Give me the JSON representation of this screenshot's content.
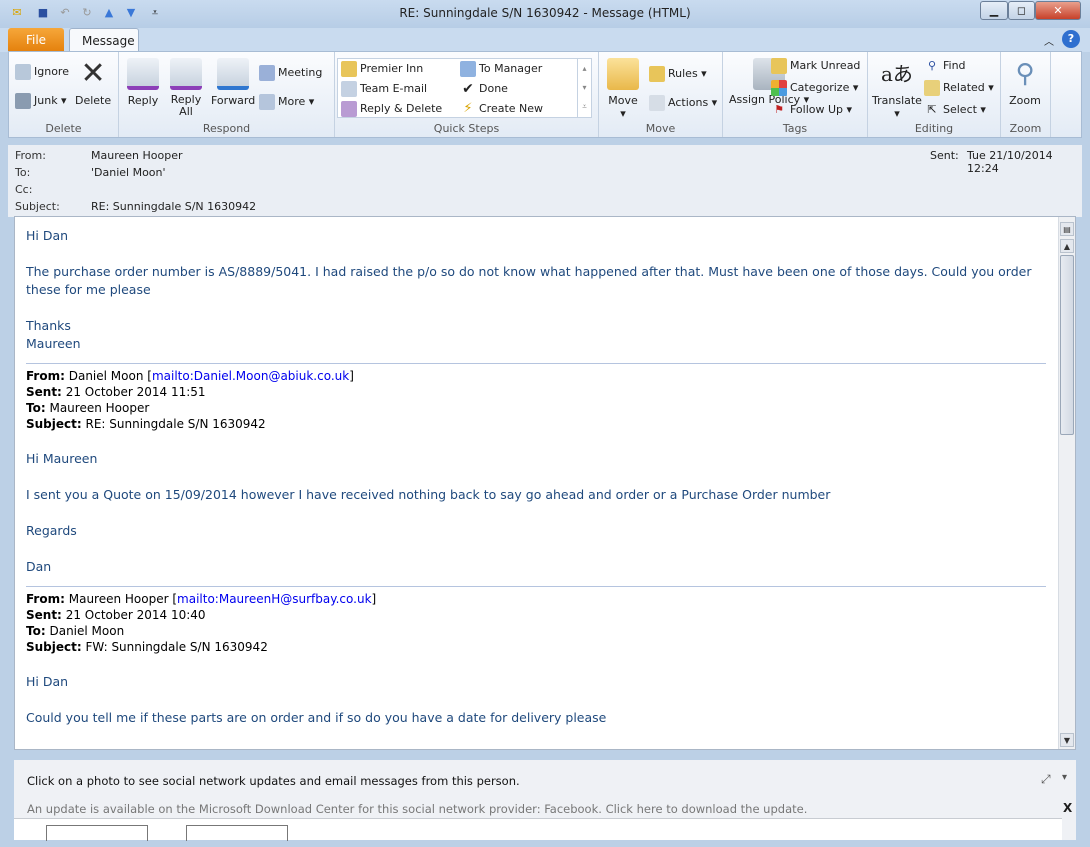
{
  "window": {
    "title": "RE: Sunningdale  S/N  1630942  -  Message (HTML)"
  },
  "tabs": [
    {
      "label": "File"
    },
    {
      "label": "Message"
    }
  ],
  "ribbon": {
    "delete": {
      "label": "Delete",
      "ignore": "Ignore",
      "junk": "Junk",
      "delete": "Delete"
    },
    "respond": {
      "label": "Respond",
      "reply": "Reply",
      "reply_all": "Reply All",
      "forward": "Forward",
      "meeting": "Meeting",
      "more": "More"
    },
    "quick_steps": {
      "label": "Quick Steps",
      "items": [
        "Premier Inn",
        "To Manager",
        "Team E-mail",
        "Done",
        "Reply & Delete",
        "Create New"
      ]
    },
    "move": {
      "label": "Move",
      "move": "Move",
      "rules": "Rules",
      "actions": "Actions"
    },
    "tags": {
      "label": "Tags",
      "assign_policy": "Assign Policy",
      "mark_unread": "Mark Unread",
      "categorize": "Categorize",
      "follow_up": "Follow Up"
    },
    "editing": {
      "label": "Editing",
      "translate": "Translate",
      "find": "Find",
      "related": "Related",
      "select": "Select"
    },
    "zoom": {
      "label": "Zoom",
      "zoom": "Zoom"
    }
  },
  "header": {
    "from_label": "From:",
    "from": "Maureen Hooper",
    "to_label": "To:",
    "to": "'Daniel Moon'",
    "cc_label": "Cc:",
    "subject_label": "Subject:",
    "subject": "RE: Sunningdale  S/N  1630942",
    "sent_label": "Sent:",
    "sent": "Tue 21/10/2014 12:24"
  },
  "body": {
    "greeting": "Hi Dan",
    "p1": "The purchase order number is AS/8889/5041.  I had raised the p/o so do not know what happened after that.  Must have been one of those days.  Could you order these for me please",
    "thanks": "Thanks",
    "sig": "Maureen",
    "q1": {
      "from_label": "From:",
      "from": "Daniel Moon [",
      "mail": "mailto:Daniel.Moon@abiuk.co.uk",
      "close": "]",
      "sent_label": "Sent:",
      "sent": "21 October 2014 11:51",
      "to_label": "To:",
      "to": "Maureen Hooper",
      "subject_label": "Subject:",
      "subject": "RE: Sunningdale S/N 1630942",
      "greeting": "Hi Maureen",
      "p1": "I sent you a Quote on 15/09/2014 however I have received nothing back to say go ahead and order or a Purchase Order number",
      "regards": "Regards",
      "sig": "Dan"
    },
    "q2": {
      "from_label": "From:",
      "from": "Maureen Hooper [",
      "mail": "mailto:MaureenH@surfbay.co.uk",
      "close": "]",
      "sent_label": "Sent:",
      "sent": "21 October 2014 10:40",
      "to_label": "To:",
      "to": "Daniel Moon",
      "subject_label": "Subject:",
      "subject": "FW: Sunningdale S/N 1630942",
      "greeting": "Hi Dan",
      "p1": "Could you tell me if these parts are on order and if so do you have a date for delivery please"
    }
  },
  "social": {
    "info": "Click on a photo to see social network updates and email messages from this person.",
    "update": "An update is available on the Microsoft Download Center for this social network provider: Facebook. Click here to download the update.",
    "close": "X"
  }
}
